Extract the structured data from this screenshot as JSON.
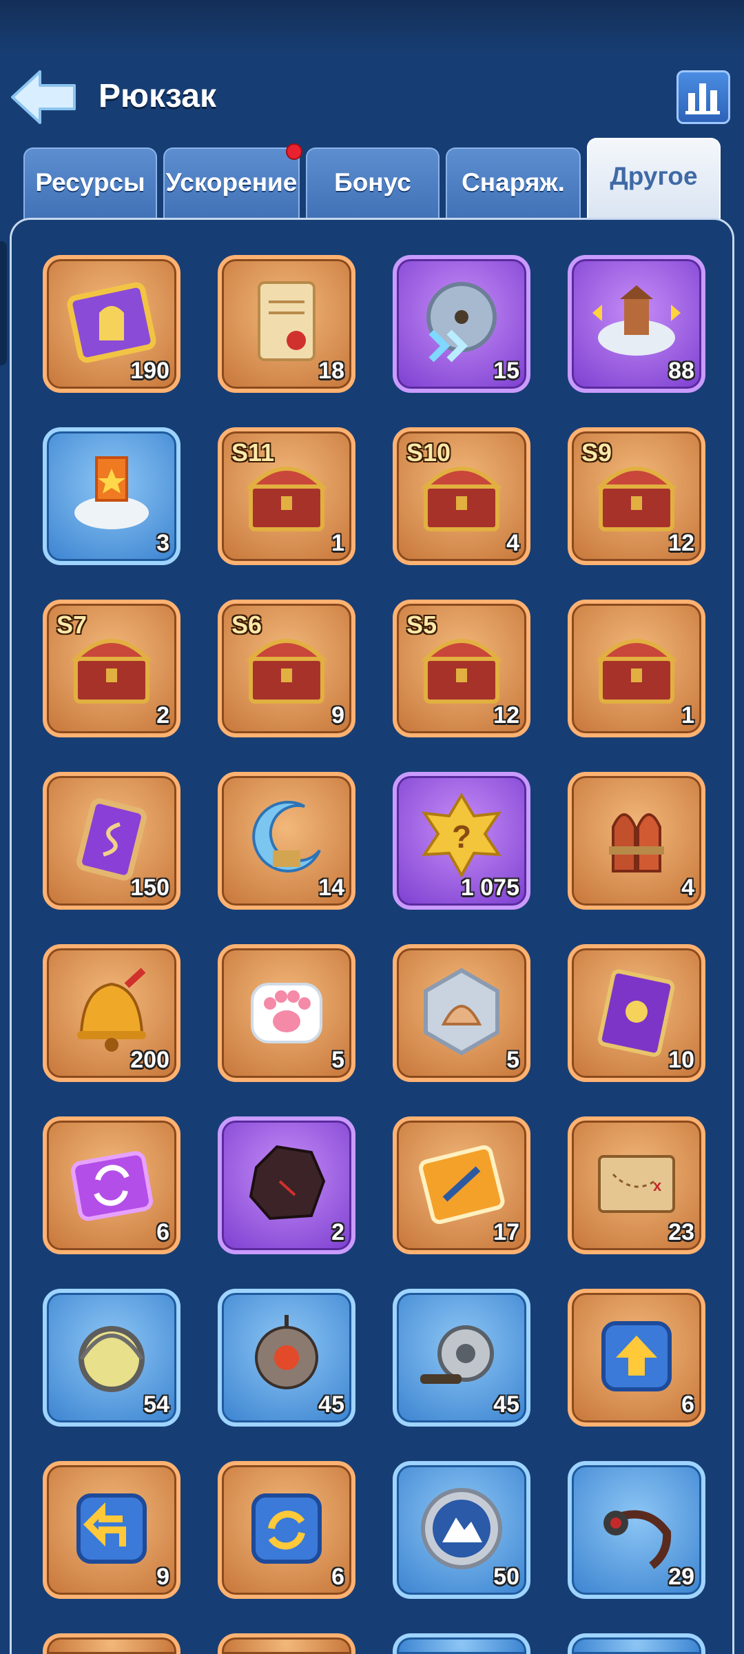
{
  "header": {
    "title": "Рюкзак",
    "back_icon": "back-arrow-icon",
    "stats_icon": "bar-chart-icon"
  },
  "tabs": [
    {
      "label": "Ресурсы",
      "active": false
    },
    {
      "label": "Ускорение",
      "active": false,
      "notification": true
    },
    {
      "label": "Бонус",
      "active": false
    },
    {
      "label": "Снаряж.",
      "active": false
    },
    {
      "label": "Другое",
      "active": true
    }
  ],
  "colors": {
    "background": "#173e74",
    "rarity_orange": "#ffb272",
    "rarity_purple": "#c99bff",
    "rarity_blue": "#9ed4ff",
    "notification_dot": "#e8222e"
  },
  "items": [
    {
      "icon": "golden-ticket-icon",
      "rarity": "orange",
      "count": "190"
    },
    {
      "icon": "scroll-with-seal-icon",
      "rarity": "orange",
      "count": "18"
    },
    {
      "icon": "compass-speed-icon",
      "rarity": "purple",
      "count": "15"
    },
    {
      "icon": "relocate-building-icon",
      "rarity": "purple",
      "count": "88"
    },
    {
      "icon": "banner-relocate-icon",
      "rarity": "blue",
      "count": "3"
    },
    {
      "icon": "treasure-chest-icon",
      "rarity": "orange",
      "count": "1",
      "season": "S11"
    },
    {
      "icon": "treasure-chest-icon",
      "rarity": "orange",
      "count": "4",
      "season": "S10"
    },
    {
      "icon": "treasure-chest-icon",
      "rarity": "orange",
      "count": "12",
      "season": "S9"
    },
    {
      "icon": "treasure-chest-icon",
      "rarity": "orange",
      "count": "2",
      "season": "S7"
    },
    {
      "icon": "treasure-chest-icon",
      "rarity": "orange",
      "count": "9",
      "season": "S6"
    },
    {
      "icon": "treasure-chest-icon",
      "rarity": "orange",
      "count": "12",
      "season": "S5"
    },
    {
      "icon": "treasure-chest-icon",
      "rarity": "orange",
      "count": "1"
    },
    {
      "icon": "purple-rune-card-icon",
      "rarity": "orange",
      "count": "150"
    },
    {
      "icon": "crescent-moon-icon",
      "rarity": "orange",
      "count": "14"
    },
    {
      "icon": "mystery-badge-icon",
      "rarity": "purple",
      "count": "1 075"
    },
    {
      "icon": "rockets-icon",
      "rarity": "orange",
      "count": "4"
    },
    {
      "icon": "golden-bell-icon",
      "rarity": "orange",
      "count": "200"
    },
    {
      "icon": "paw-print-icon",
      "rarity": "orange",
      "count": "5"
    },
    {
      "icon": "shell-token-icon",
      "rarity": "orange",
      "count": "5"
    },
    {
      "icon": "purple-card-icon",
      "rarity": "orange",
      "count": "10"
    },
    {
      "icon": "swap-ticket-icon",
      "rarity": "orange",
      "count": "6"
    },
    {
      "icon": "dark-ore-icon",
      "rarity": "purple",
      "count": "2"
    },
    {
      "icon": "fishing-ticket-icon",
      "rarity": "orange",
      "count": "17"
    },
    {
      "icon": "treasure-map-icon",
      "rarity": "orange",
      "count": "23"
    },
    {
      "icon": "lamp-icon",
      "rarity": "blue",
      "count": "54"
    },
    {
      "icon": "robot-bomb-icon",
      "rarity": "blue",
      "count": "45"
    },
    {
      "icon": "fishing-reel-icon",
      "rarity": "blue",
      "count": "45"
    },
    {
      "icon": "upgrade-arrow-icon",
      "rarity": "orange",
      "count": "6"
    },
    {
      "icon": "return-arrow-icon",
      "rarity": "orange",
      "count": "9"
    },
    {
      "icon": "refresh-arrows-icon",
      "rarity": "orange",
      "count": "6"
    },
    {
      "icon": "mountain-coin-icon",
      "rarity": "blue",
      "count": "50"
    },
    {
      "icon": "anchor-hook-icon",
      "rarity": "blue",
      "count": "29"
    }
  ]
}
